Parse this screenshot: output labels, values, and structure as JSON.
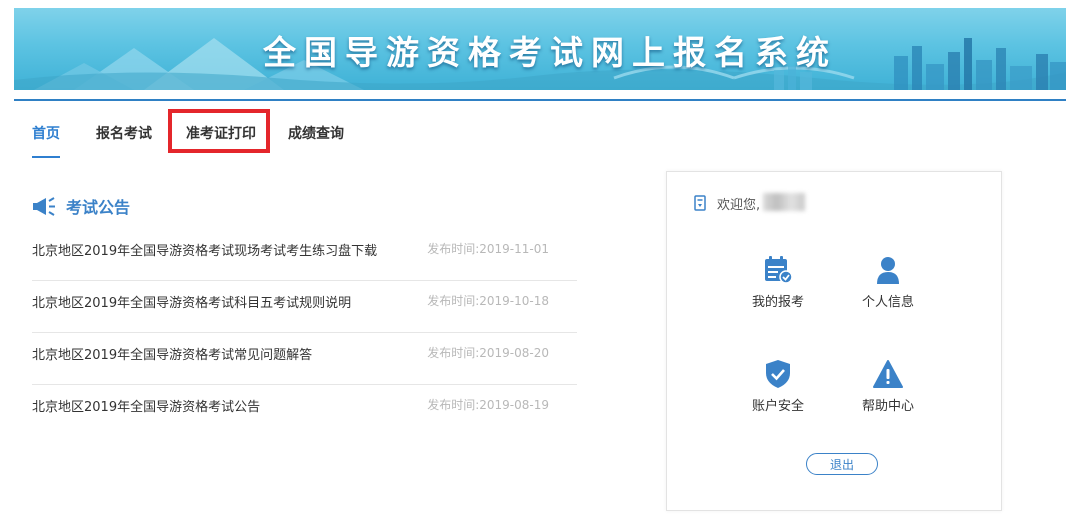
{
  "banner": {
    "title": "全国导游资格考试网上报名系统"
  },
  "nav": {
    "items": [
      {
        "label": "首页",
        "active": true
      },
      {
        "label": "报名考试",
        "active": false
      },
      {
        "label": "准考证打印",
        "active": false,
        "highlighted": true
      },
      {
        "label": "成绩查询",
        "active": false
      }
    ]
  },
  "notices": {
    "title": "考试公告",
    "icon": "megaphone-icon",
    "items": [
      {
        "title": "北京地区2019年全国导游资格考试现场考试考生练习盘下载",
        "date": "发布时间:2019-11-01"
      },
      {
        "title": "北京地区2019年全国导游资格考试科目五考试规则说明",
        "date": "发布时间:2019-10-18"
      },
      {
        "title": "北京地区2019年全国导游资格考试常见问题解答",
        "date": "发布时间:2019-08-20"
      },
      {
        "title": "北京地区2019年全国导游资格考试公告",
        "date": "发布时间:2019-08-19"
      }
    ]
  },
  "panel": {
    "welcome": "欢迎您,",
    "tiles": [
      {
        "label": "我的报考",
        "icon": "calendar-check-icon"
      },
      {
        "label": "个人信息",
        "icon": "user-icon"
      },
      {
        "label": "账户安全",
        "icon": "shield-check-icon"
      },
      {
        "label": "帮助中心",
        "icon": "warning-icon"
      }
    ],
    "logout": "退出"
  },
  "colors": {
    "accent": "#3b82c8",
    "highlight": "#e4262b",
    "banner": "#5cc3e2"
  }
}
